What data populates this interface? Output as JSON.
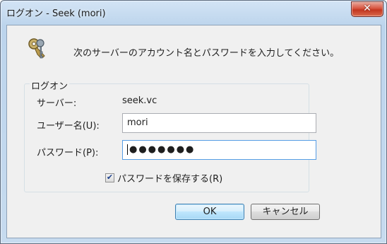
{
  "window": {
    "title": "ログオン - Seek (mori)",
    "close_symbol": "✕"
  },
  "dialog": {
    "icon": "keys-icon",
    "message": "次のサーバーのアカウント名とパスワードを入力してください。",
    "group_label": "ログオン",
    "server_label": "サーバー:",
    "server_value": "seek.vc",
    "username_label": "ユーザー名(U):",
    "username_value": "mori",
    "password_label": "パスワード(P):",
    "password_value": "●●●●●●●",
    "save_password_label": "パスワードを保存する(R)",
    "save_password_checked": true,
    "check_symbol": "✔",
    "ok_label": "OK",
    "cancel_label": "キャンセル"
  },
  "colors": {
    "close_button": "#c3361f",
    "default_button_border": "#3c7fb1",
    "focus_border": "#569de5"
  }
}
